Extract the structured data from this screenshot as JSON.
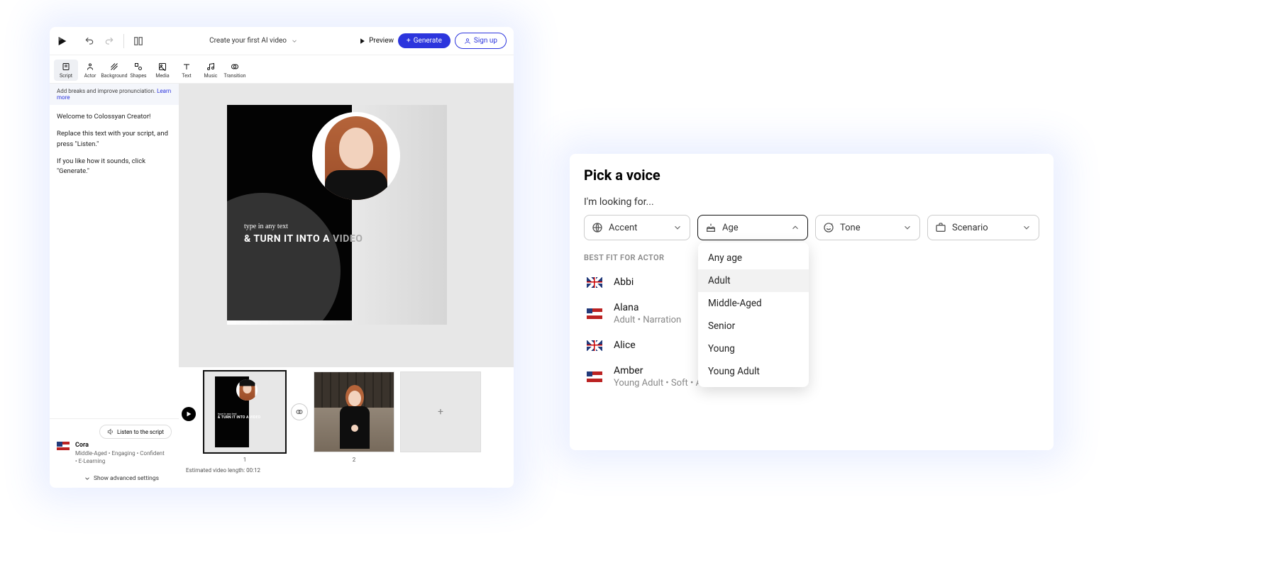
{
  "left": {
    "header": {
      "title": "Create your first AI video",
      "preview": "Preview",
      "generate": "Generate",
      "signup": "Sign up"
    },
    "toolbar": [
      {
        "label": "Script",
        "icon": "script-icon"
      },
      {
        "label": "Actor",
        "icon": "actor-icon"
      },
      {
        "label": "Background",
        "icon": "background-icon"
      },
      {
        "label": "Shapes",
        "icon": "shapes-icon"
      },
      {
        "label": "Media",
        "icon": "media-icon"
      },
      {
        "label": "Text",
        "icon": "text-icon"
      },
      {
        "label": "Music",
        "icon": "music-icon"
      },
      {
        "label": "Transition",
        "icon": "transition-icon"
      }
    ],
    "hint": {
      "text": "Add breaks and improve pronunciation. ",
      "link": "Learn more"
    },
    "script": {
      "p1": "Welcome to Colossyan Creator!",
      "p2": "Replace this text with your script, and press \"Listen.\"",
      "p3": "If you like how it sounds, click \"Generate.\""
    },
    "listen": "Listen to the script",
    "voice": {
      "name": "Cora",
      "meta": "Middle-Aged • Engaging • Confident • E-Learning"
    },
    "advanced": "Show advanced settings",
    "stage": {
      "line1": "type in any text",
      "line2a": "& TURN IT INTO A ",
      "line2b": "VIDEO"
    },
    "thumbs": {
      "n1": "1",
      "n2": "2"
    },
    "est": "Estimated video length:  00:12"
  },
  "right": {
    "title": "Pick a voice",
    "looking": "I'm looking for...",
    "filters": {
      "accent": "Accent",
      "age": "Age",
      "tone": "Tone",
      "scenario": "Scenario"
    },
    "age_options": [
      "Any age",
      "Adult",
      "Middle-Aged",
      "Senior",
      "Young",
      "Young Adult"
    ],
    "age_selected": "Adult",
    "bestfit": "BEST FIT FOR ACTOR",
    "voices": [
      {
        "name": "Abbi",
        "meta": "",
        "flag": "uk"
      },
      {
        "name": "Alana",
        "meta": "Adult • Narration",
        "flag": "us"
      },
      {
        "name": "Alice",
        "meta": "",
        "flag": "uk"
      },
      {
        "name": "Amber",
        "meta": "Young Adult • Soft • Assistant",
        "flag": "us"
      }
    ]
  }
}
